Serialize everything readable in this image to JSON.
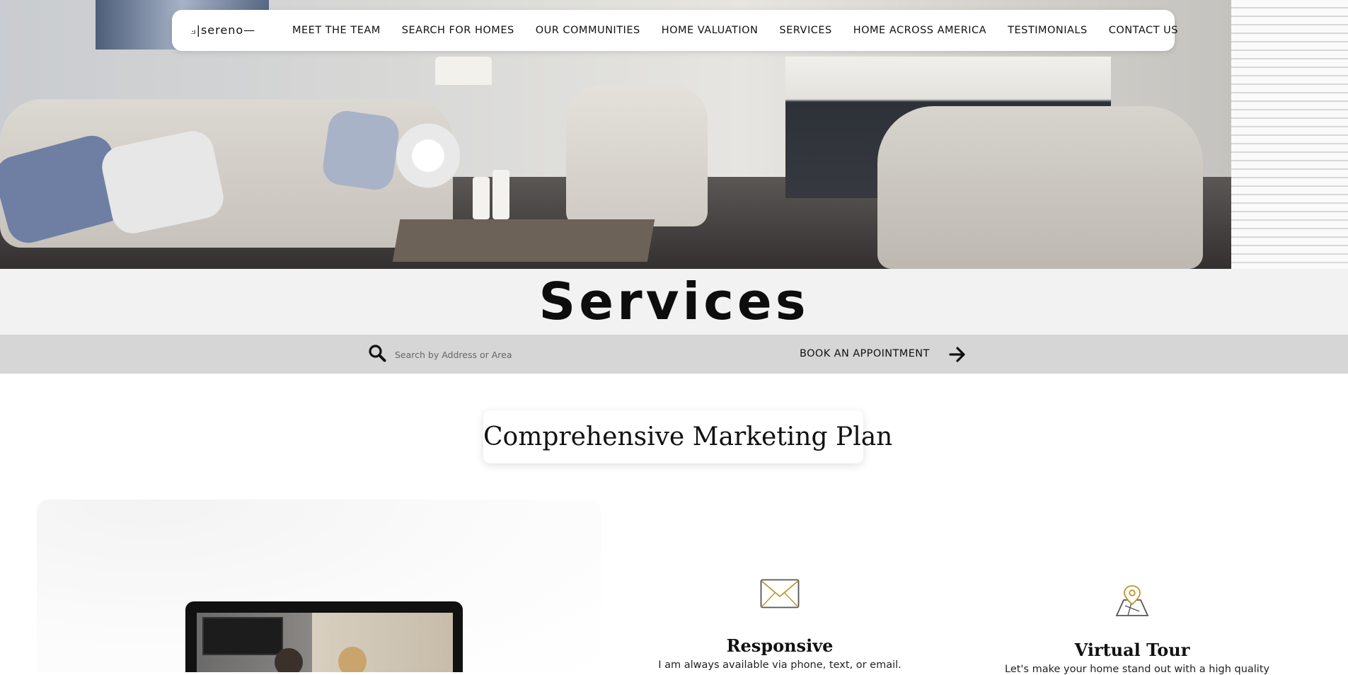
{
  "nav": {
    "logo": "⟓|sereno—",
    "items": [
      {
        "label": "MEET THE TEAM"
      },
      {
        "label": "SEARCH FOR HOMES"
      },
      {
        "label": "OUR COMMUNITIES"
      },
      {
        "label": "HOME VALUATION"
      },
      {
        "label": "SERVICES"
      },
      {
        "label": "HOME ACROSS AMERICA"
      },
      {
        "label": "TESTIMONIALS"
      },
      {
        "label": "CONTACT US"
      }
    ]
  },
  "page": {
    "title": "Services"
  },
  "search": {
    "placeholder": "Search by Address or Area",
    "value": ""
  },
  "appointment": {
    "label": "BOOK AN APPOINTMENT"
  },
  "section": {
    "title": "Comprehensive Marketing Plan"
  },
  "features": [
    {
      "icon": "envelope-icon",
      "title": "Responsive",
      "text": "I am always available via phone, text, or email."
    },
    {
      "icon": "map-pin-icon",
      "title": "Virtual Tour",
      "text": "Let's make your home stand out with a high quality"
    }
  ],
  "colors": {
    "accent": "#b8962e",
    "band": "#f2f2f2",
    "search_band": "#d6d6d6"
  }
}
